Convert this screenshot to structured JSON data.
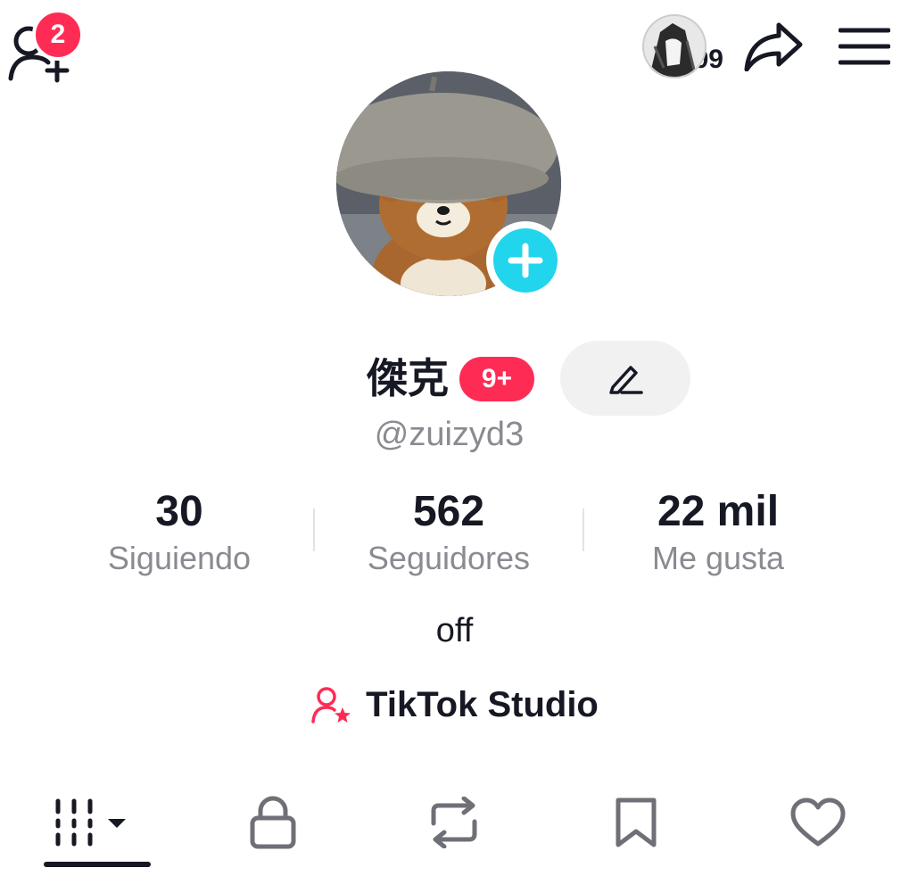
{
  "header": {
    "friend_requests_count": "2",
    "story_views_count": "99"
  },
  "profile": {
    "display_name": "傑克",
    "name_badge": "9+",
    "username": "@zuizyd3",
    "bio": "off"
  },
  "stats": [
    {
      "value": "30",
      "label": "Siguiendo"
    },
    {
      "value": "562",
      "label": "Seguidores"
    },
    {
      "value": "22 mil",
      "label": "Me gusta"
    }
  ],
  "studio": {
    "label": "TikTok Studio"
  },
  "colors": {
    "accent": "#fe2c55",
    "add_button": "#20d5ec",
    "text": "#161823",
    "muted": "#8a8b91"
  },
  "tabs": [
    {
      "icon": "grid-videos-icon",
      "selected": true
    },
    {
      "icon": "lock-icon",
      "selected": false
    },
    {
      "icon": "repost-icon",
      "selected": false
    },
    {
      "icon": "bookmark-icon",
      "selected": false
    },
    {
      "icon": "heart-icon",
      "selected": false
    }
  ]
}
